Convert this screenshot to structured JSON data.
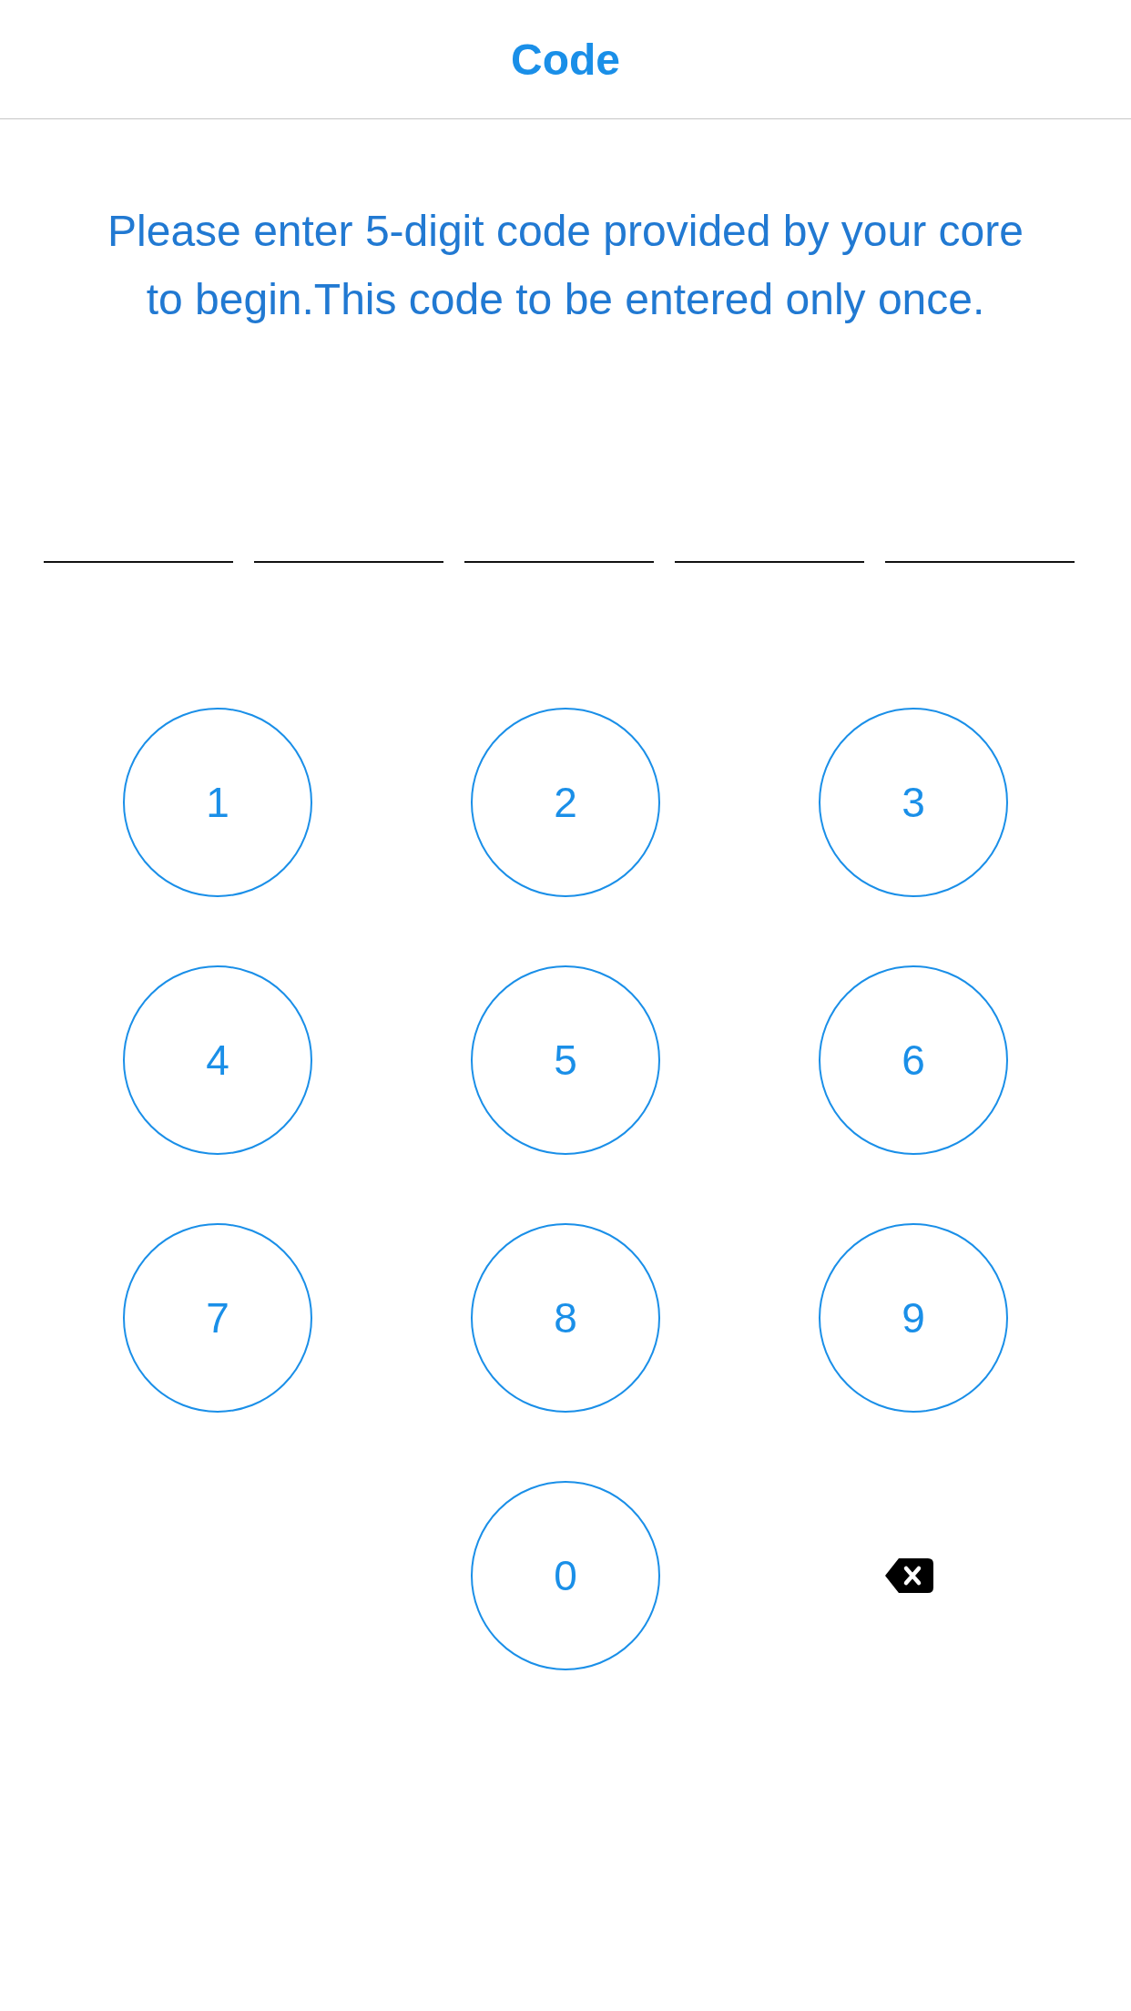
{
  "header": {
    "title": "Code"
  },
  "instructions": "Please enter 5-digit code provided by your core to begin.This code to be entered only once.",
  "code_slots": [
    {
      "filled": false
    },
    {
      "filled": false
    },
    {
      "filled": false
    },
    {
      "filled": false
    },
    {
      "filled": false
    }
  ],
  "keypad": [
    {
      "kind": "digit",
      "label": "1"
    },
    {
      "kind": "digit",
      "label": "2"
    },
    {
      "kind": "digit",
      "label": "3"
    },
    {
      "kind": "digit",
      "label": "4"
    },
    {
      "kind": "digit",
      "label": "5"
    },
    {
      "kind": "digit",
      "label": "6"
    },
    {
      "kind": "digit",
      "label": "7"
    },
    {
      "kind": "digit",
      "label": "8"
    },
    {
      "kind": "digit",
      "label": "9"
    },
    {
      "kind": "digit",
      "label": "0"
    },
    {
      "kind": "backspace"
    }
  ]
}
